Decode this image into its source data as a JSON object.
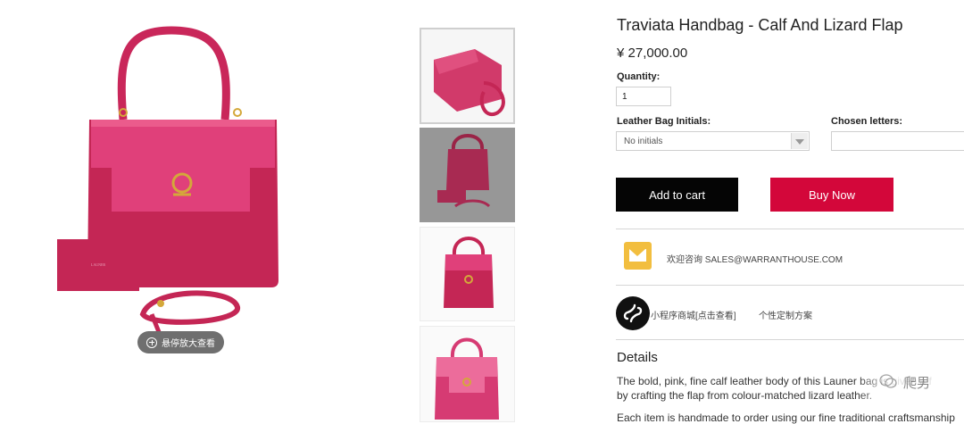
{
  "product": {
    "title": "Traviata Handbag - Calf And Lizard Flap",
    "price": "¥ 27,000.00"
  },
  "colors": {
    "bag_body": "#c9275a",
    "lizard_flap": "#e0407a",
    "hardware": "#d4a83a",
    "buy_now": "#d3073a",
    "add_to_cart": "#050505",
    "mail_icon": "#f2be3f"
  },
  "gallery": {
    "zoom_hint": "悬停放大查看",
    "zoom_icon": "plus-circle-icon",
    "thumbnails_count": 4
  },
  "form": {
    "quantity_label": "Quantity:",
    "quantity_value": "1",
    "initials_label": "Leather Bag Initials:",
    "initials_value": "No initials",
    "letters_label": "Chosen letters:"
  },
  "buttons": {
    "add_to_cart": "Add to cart",
    "buy_now": "Buy Now"
  },
  "contact": {
    "icon": "mail-icon",
    "text": "欢迎咨询 SALES@WARRANTHOUSE.COM"
  },
  "links": {
    "icon": "mini-program-icon",
    "miniprogram": "小程序商城[点击查看]",
    "custom": "个性定制方案"
  },
  "details": {
    "heading": "Details",
    "line1": "The bold, pink, fine calf leather body of this Launer bag is given a f",
    "line2": "by crafting the flap from colour-matched lizard leather.",
    "line3": "Each item is handmade to order using our fine traditional craftsmanship"
  },
  "watermark": "爬男"
}
